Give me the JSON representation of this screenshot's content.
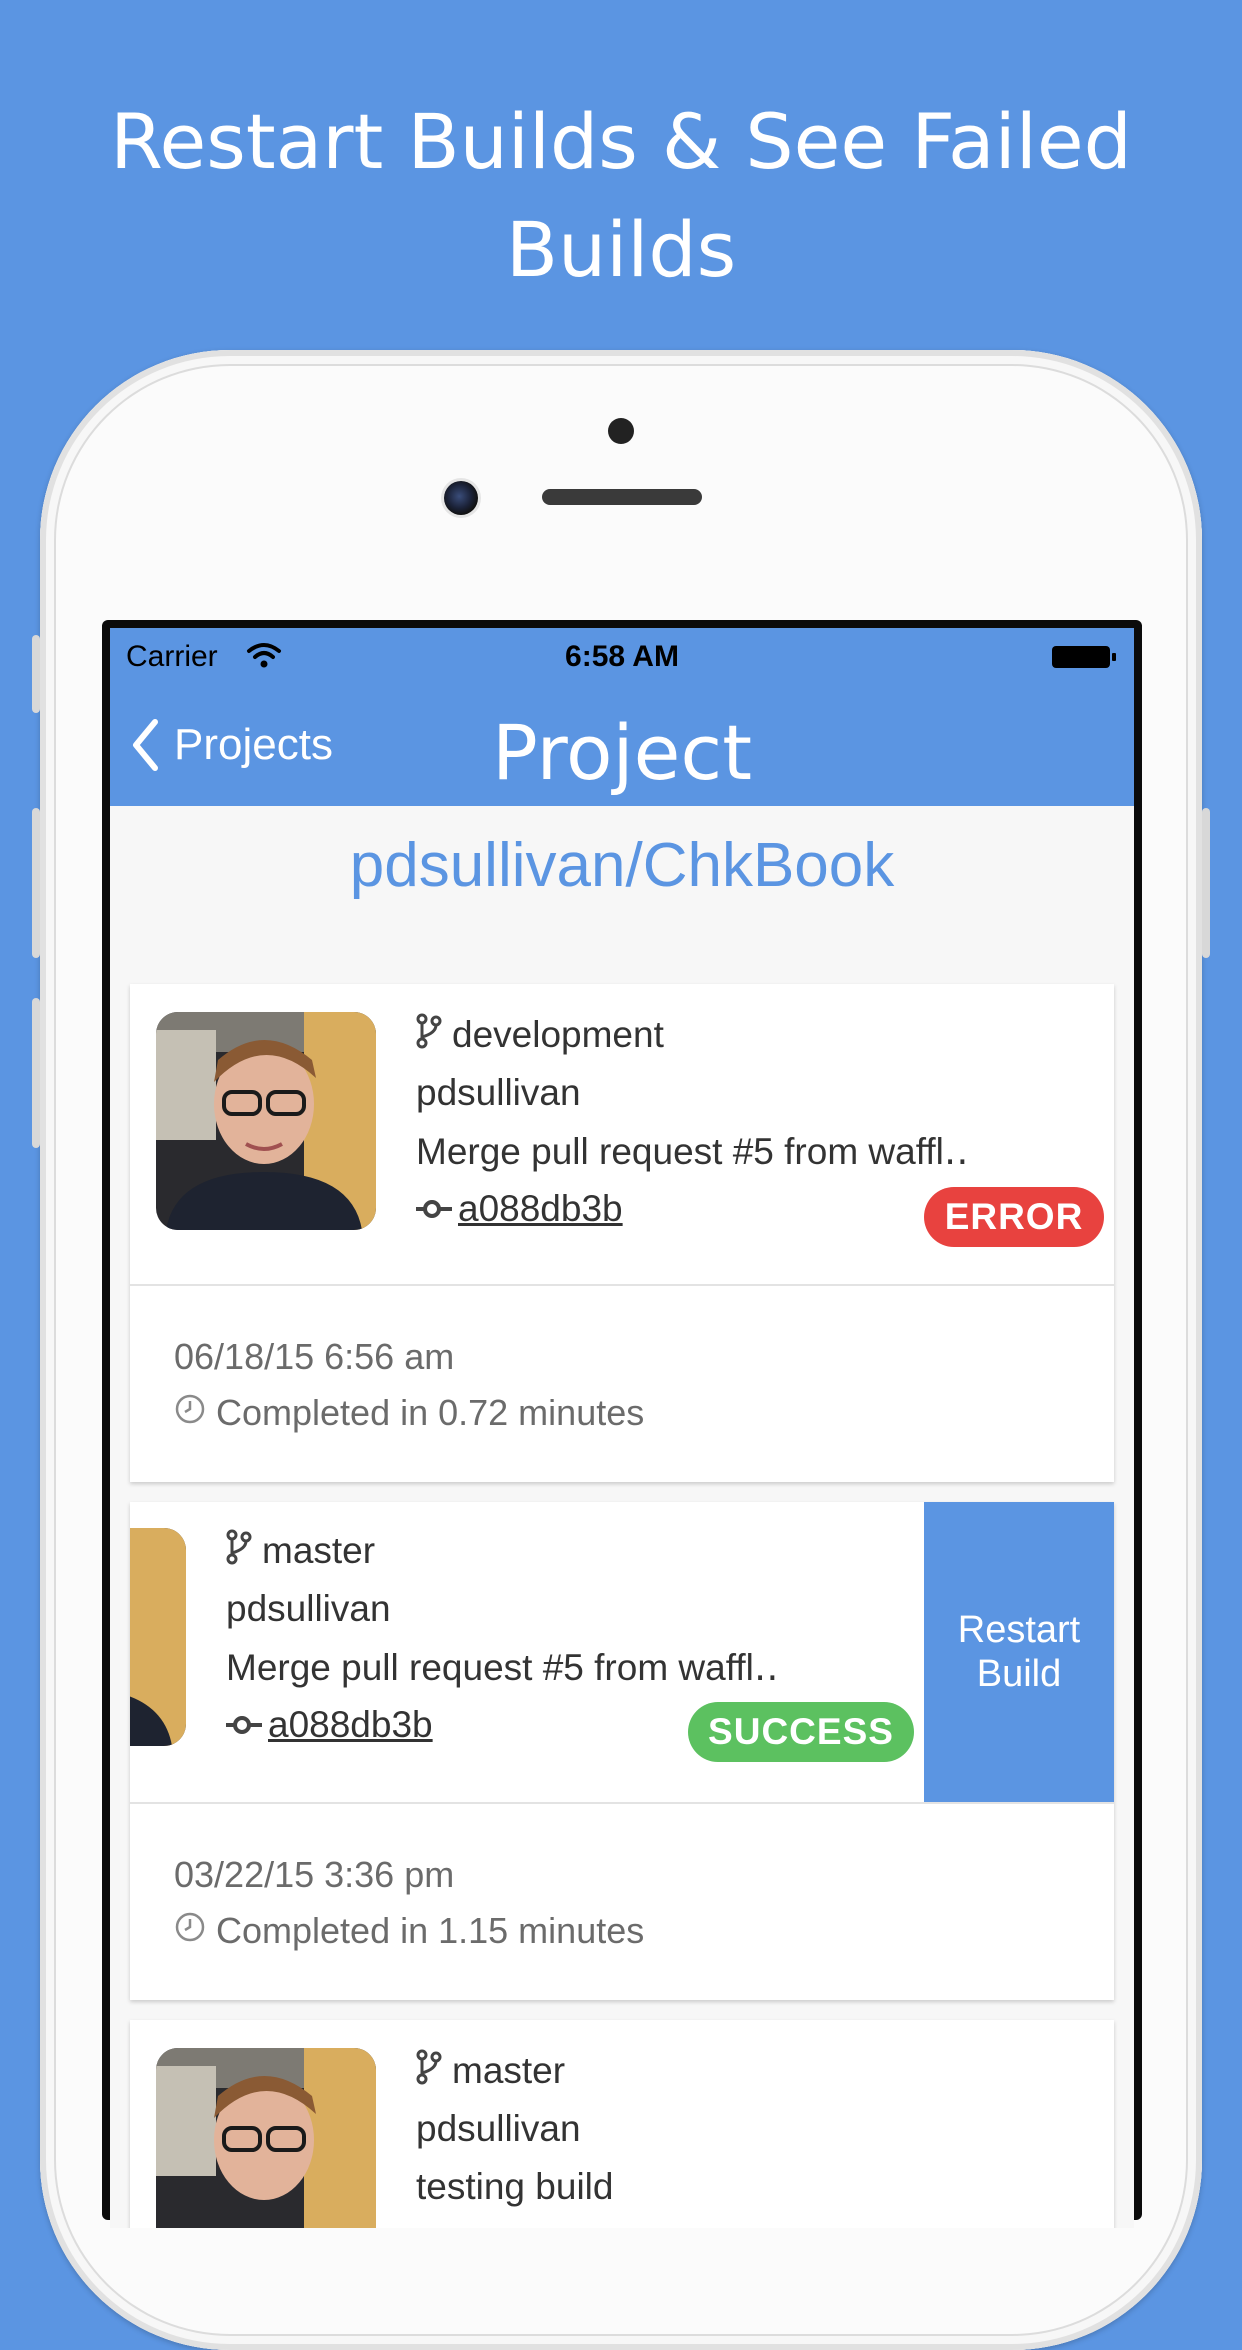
{
  "headline": {
    "line1": "Restart Builds & See Failed",
    "line2": "Builds"
  },
  "status_bar": {
    "carrier": "Carrier",
    "time": "6:58 AM"
  },
  "nav": {
    "back_label": "Projects",
    "title": "Project"
  },
  "repo_name": "pdsullivan/ChkBook",
  "builds": [
    {
      "branch": "development",
      "user": "pdsullivan",
      "message": "Merge pull request #5 from waffl‥",
      "commit": "a088db3b",
      "status": "ERROR",
      "date": "06/18/15 6:56 am",
      "duration": "Completed in 0.72 minutes"
    },
    {
      "branch": "master",
      "user": "pdsullivan",
      "message": "Merge pull request #5 from waffl‥",
      "commit": "a088db3b",
      "status": "SUCCESS",
      "date": "03/22/15 3:36 pm",
      "duration": "Completed in 1.15 minutes",
      "action": "Restart Build"
    },
    {
      "branch": "master",
      "user": "pdsullivan",
      "message": "testing build"
    }
  ],
  "colors": {
    "brand_blue": "#5b95e2",
    "error": "#e8423f",
    "success": "#5cc160"
  }
}
